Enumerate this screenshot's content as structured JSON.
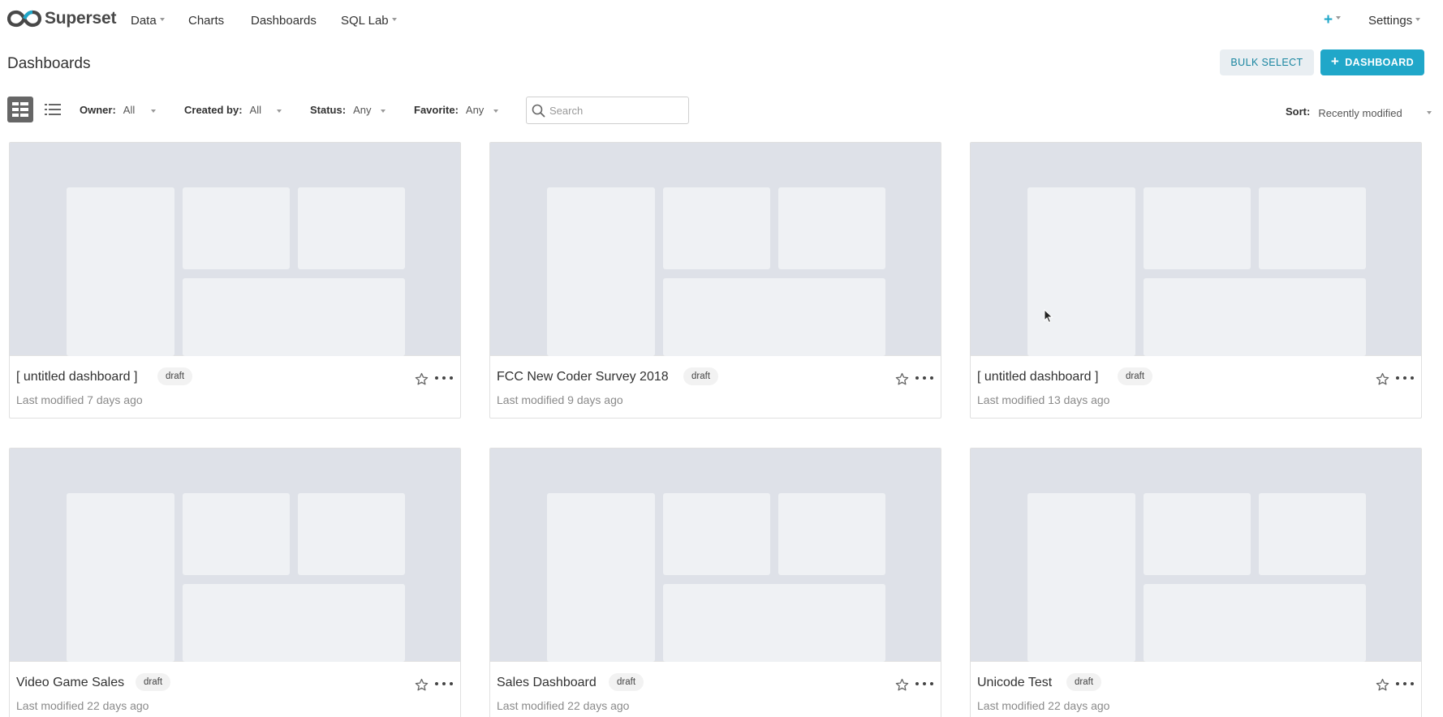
{
  "brand": {
    "name": "Superset"
  },
  "nav": {
    "items": [
      {
        "label": "Data",
        "dropdown": true
      },
      {
        "label": "Charts",
        "dropdown": false
      },
      {
        "label": "Dashboards",
        "dropdown": false
      },
      {
        "label": "SQL Lab",
        "dropdown": true
      }
    ],
    "add_menu_label": "+",
    "settings_label": "Settings"
  },
  "page": {
    "title": "Dashboards",
    "bulk_select_label": "BULK SELECT",
    "add_dashboard_label": "DASHBOARD"
  },
  "filters": {
    "owner": {
      "label": "Owner:",
      "value": "All"
    },
    "created_by": {
      "label": "Created by:",
      "value": "All"
    },
    "status": {
      "label": "Status:",
      "value": "Any"
    },
    "favorite": {
      "label": "Favorite:",
      "value": "Any"
    },
    "search": {
      "placeholder": "Search",
      "value": ""
    },
    "sort": {
      "label": "Sort:",
      "value": "Recently modified"
    },
    "view_mode": "card"
  },
  "cards": [
    {
      "title": "[ untitled dashboard ]",
      "status": "draft",
      "modified": "Last modified 7 days ago",
      "favorite": false
    },
    {
      "title": "FCC New Coder Survey 2018",
      "status": "draft",
      "modified": "Last modified 9 days ago",
      "favorite": false
    },
    {
      "title": "[ untitled dashboard ]",
      "status": "draft",
      "modified": "Last modified 13 days ago",
      "favorite": false
    },
    {
      "title": "Video Game Sales",
      "status": "draft",
      "modified": "Last modified 22 days ago",
      "favorite": false
    },
    {
      "title": "Sales Dashboard",
      "status": "draft",
      "modified": "Last modified 22 days ago",
      "favorite": false
    },
    {
      "title": "Unicode Test",
      "status": "draft",
      "modified": "Last modified 22 days ago",
      "favorite": false
    }
  ],
  "colors": {
    "primary": "#20a7c9",
    "secondary_button_bg": "#e9eef2",
    "thumbnail_bg": "#dee1e8",
    "thumbnail_block": "#eff1f4"
  }
}
